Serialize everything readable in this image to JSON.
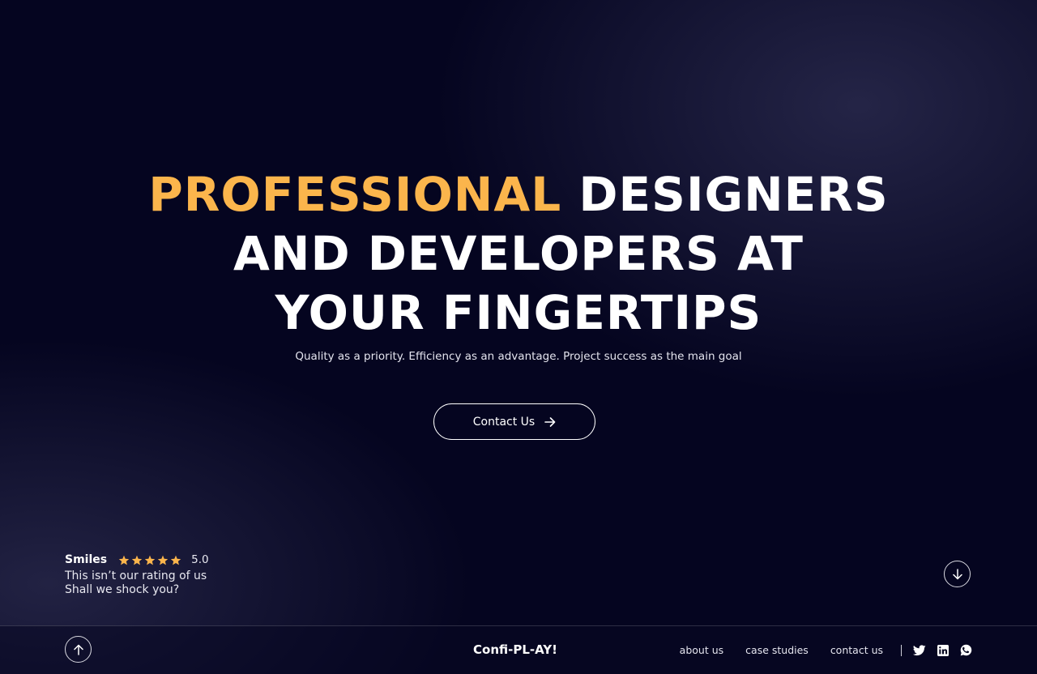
{
  "hero": {
    "title_accent": "PROFESSIONAL",
    "title_line1_rest": "DESIGNERS",
    "title_line2": "AND DEVELOPERS AT",
    "title_line3": "YOUR FINGERTIPS",
    "subtitle": "Quality as a priority. Efficiency as an advantage. Project success as the main goal",
    "cta_label": "Contact Us",
    "cta_icon": "arrow-right-icon"
  },
  "rating": {
    "brand": "Smiles",
    "stars": 5,
    "score": "5.0",
    "line1": "This isn’t our rating of us",
    "line2": "Shall we shock you?",
    "star_color": "#fbb54c"
  },
  "controls": {
    "scroll_down_icon": "arrow-down-icon",
    "scroll_up_icon": "arrow-up-icon"
  },
  "footer": {
    "brand": "Confi-PL-AY!",
    "links": [
      "about us",
      "case studies",
      "contact us"
    ],
    "social": [
      "twitter-icon",
      "linkedin-icon",
      "whatsapp-icon"
    ]
  },
  "colors": {
    "accent": "#fbb54c",
    "background": "#050520",
    "text": "#ffffff"
  }
}
